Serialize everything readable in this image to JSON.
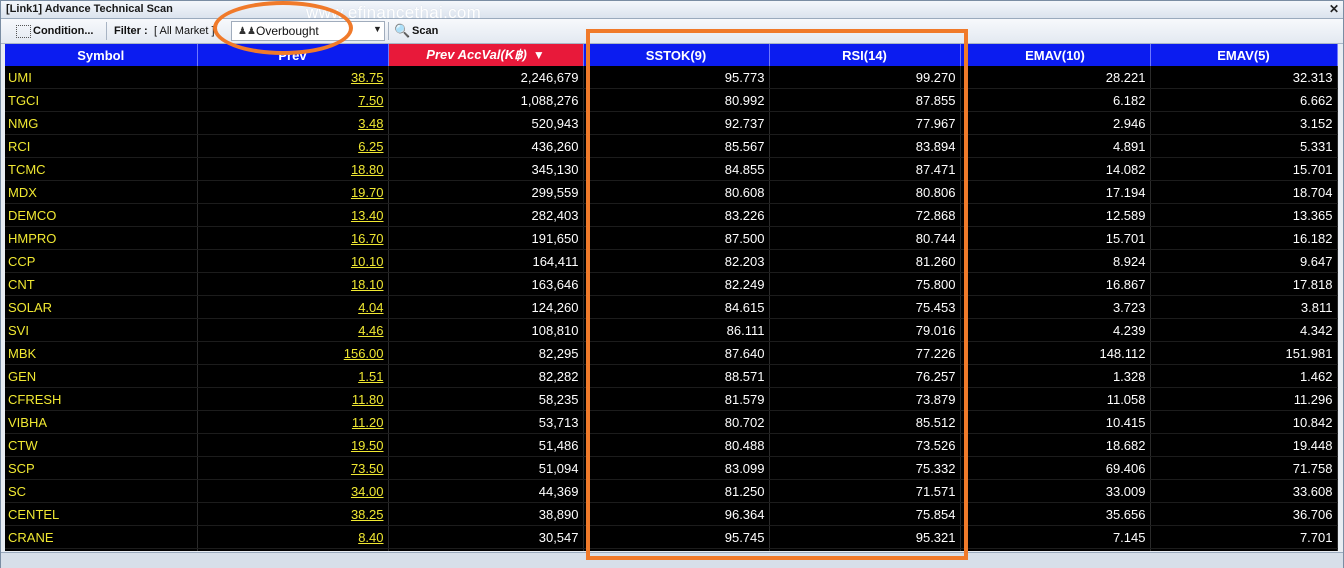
{
  "window": {
    "title": "[Link1] Advance Technical Scan",
    "watermark": "www.efinancethai.com",
    "close_label": "✕"
  },
  "toolbar": {
    "condition_label": "Condition...",
    "filter_label": "Filter :",
    "filter_value": "[ All Market ]",
    "scan_select_value": "Overbought",
    "scan_label": "Scan"
  },
  "icons": {
    "condition": "dotted-grid-icon",
    "scan_select": "people-icon",
    "scan": "magnifier-icon",
    "dropdown": "chevron-down-icon",
    "sort": "sort-descending-icon"
  },
  "colors": {
    "header_bg": "#0b1cf0",
    "sorted_header_bg": "#e8193a",
    "symbol_text": "#f0e832",
    "grid_bg": "#000000",
    "annotation": "#f07a2a"
  },
  "table": {
    "columns": [
      "Symbol",
      "Prev",
      "Prev AccVal(K฿)",
      "SSTOK(9)",
      "RSI(14)",
      "EMAV(10)",
      "EMAV(5)"
    ],
    "sorted_column_arrow": "▼",
    "rows": [
      [
        "UMI",
        "38.75",
        "2,246,679",
        "95.773",
        "99.270",
        "28.221",
        "32.313"
      ],
      [
        "TGCI",
        "7.50",
        "1,088,276",
        "80.992",
        "87.855",
        "6.182",
        "6.662"
      ],
      [
        "NMG",
        "3.48",
        "520,943",
        "92.737",
        "77.967",
        "2.946",
        "3.152"
      ],
      [
        "RCI",
        "6.25",
        "436,260",
        "85.567",
        "83.894",
        "4.891",
        "5.331"
      ],
      [
        "TCMC",
        "18.80",
        "345,130",
        "84.855",
        "87.471",
        "14.082",
        "15.701"
      ],
      [
        "MDX",
        "19.70",
        "299,559",
        "80.608",
        "80.806",
        "17.194",
        "18.704"
      ],
      [
        "DEMCO",
        "13.40",
        "282,403",
        "83.226",
        "72.868",
        "12.589",
        "13.365"
      ],
      [
        "HMPRO",
        "16.70",
        "191,650",
        "87.500",
        "80.744",
        "15.701",
        "16.182"
      ],
      [
        "CCP",
        "10.10",
        "164,411",
        "82.203",
        "81.260",
        "8.924",
        "9.647"
      ],
      [
        "CNT",
        "18.10",
        "163,646",
        "82.249",
        "75.800",
        "16.867",
        "17.818"
      ],
      [
        "SOLAR",
        "4.04",
        "124,260",
        "84.615",
        "75.453",
        "3.723",
        "3.811"
      ],
      [
        "SVI",
        "4.46",
        "108,810",
        "86.111",
        "79.016",
        "4.239",
        "4.342"
      ],
      [
        "MBK",
        "156.00",
        "82,295",
        "87.640",
        "77.226",
        "148.112",
        "151.981"
      ],
      [
        "GEN",
        "1.51",
        "82,282",
        "88.571",
        "76.257",
        "1.328",
        "1.462"
      ],
      [
        "CFRESH",
        "11.80",
        "58,235",
        "81.579",
        "73.879",
        "11.058",
        "11.296"
      ],
      [
        "VIBHA",
        "11.20",
        "53,713",
        "80.702",
        "85.512",
        "10.415",
        "10.842"
      ],
      [
        "CTW",
        "19.50",
        "51,486",
        "80.488",
        "73.526",
        "18.682",
        "19.448"
      ],
      [
        "SCP",
        "73.50",
        "51,094",
        "83.099",
        "75.332",
        "69.406",
        "71.758"
      ],
      [
        "SC",
        "34.00",
        "44,369",
        "81.250",
        "71.571",
        "33.009",
        "33.608"
      ],
      [
        "CENTEL",
        "38.25",
        "38,890",
        "96.364",
        "75.854",
        "35.656",
        "36.706"
      ],
      [
        "CRANE",
        "8.40",
        "30,547",
        "95.745",
        "95.321",
        "7.145",
        "7.701"
      ]
    ]
  }
}
